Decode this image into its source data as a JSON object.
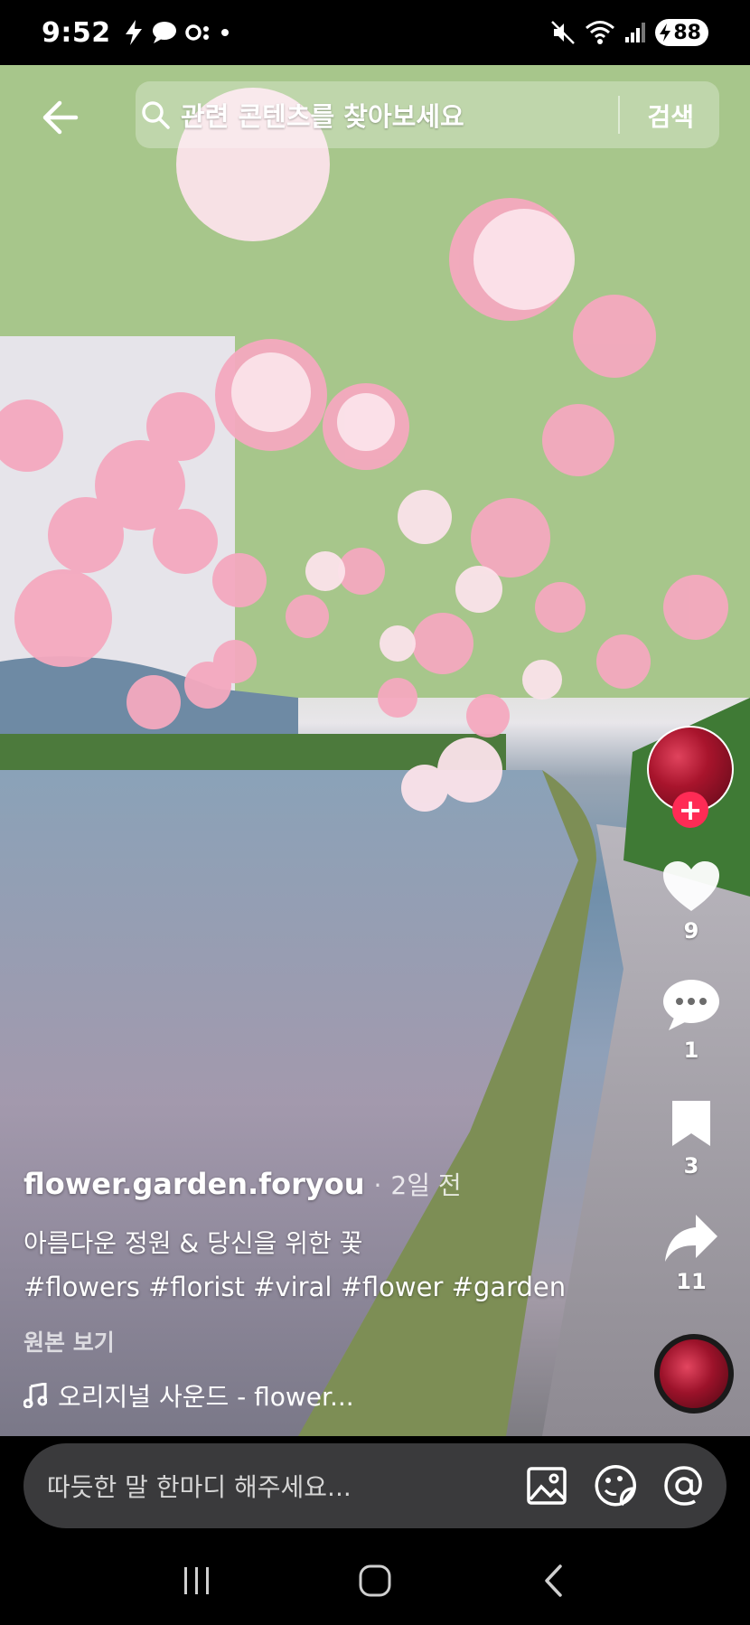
{
  "status_bar": {
    "time": "9:52",
    "battery_level": "88"
  },
  "search": {
    "placeholder": "관련 콘텐츠를 찾아보세요",
    "submit_label": "검색"
  },
  "post": {
    "username": "flower.garden.foryou",
    "separator": "·",
    "posted_time": "2일 전",
    "description": "아름다운 정원 & 당신을 위한 꽃",
    "hashtags": "#flowers #florist #viral #flower #garden",
    "view_original_label": "원본 보기",
    "sound": "오리지널 사운드 - flower..."
  },
  "actions": {
    "likes": "9",
    "comments": "1",
    "bookmarks": "3",
    "shares": "11",
    "follow_symbol": "+"
  },
  "comment": {
    "placeholder": "따듯한 말 한마디 해주세요..."
  },
  "colors": {
    "follow_accent": "#ff2b55",
    "comment_box": "#3a3a3c"
  }
}
